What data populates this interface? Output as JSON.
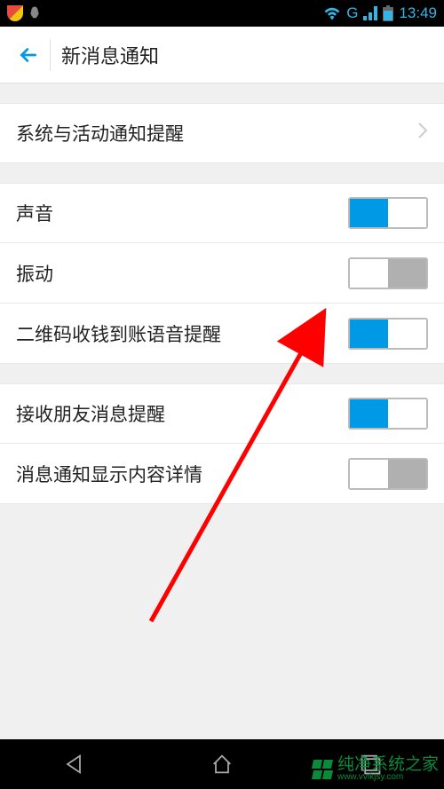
{
  "status_bar": {
    "network_label": "G",
    "time": "13:49"
  },
  "header": {
    "title": "新消息通知"
  },
  "groups": [
    {
      "rows": [
        {
          "label": "系统与活动通知提醒",
          "type": "chevron"
        }
      ]
    },
    {
      "rows": [
        {
          "label": "声音",
          "type": "toggle",
          "on": true
        },
        {
          "label": "振动",
          "type": "toggle",
          "on": false
        },
        {
          "label": "二维码收钱到账语音提醒",
          "type": "toggle",
          "on": true
        }
      ]
    },
    {
      "rows": [
        {
          "label": "接收朋友消息提醒",
          "type": "toggle",
          "on": true
        },
        {
          "label": "消息通知显示内容详情",
          "type": "toggle",
          "on": false
        }
      ]
    }
  ],
  "watermark": {
    "text": "纯净系统之家",
    "url": "www.vvikjsy.com"
  },
  "colors": {
    "accent": "#0099e5",
    "toggle_off": "#b0b0b0",
    "arrow": "#ff0000"
  }
}
